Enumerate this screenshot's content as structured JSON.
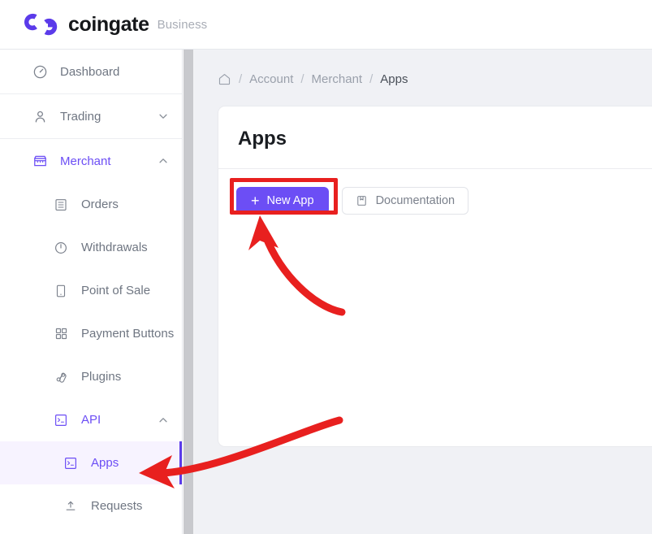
{
  "topbar": {
    "logo_icon": "coingate-cg-logo-icon",
    "brand_name": "coingate",
    "brand_suffix": "Business",
    "brand_color": "#5b3bea"
  },
  "sidebar": {
    "groups": [
      {
        "items": [
          {
            "label": "Dashboard",
            "icon": "speedometer-icon",
            "state": "default",
            "expandable": false
          }
        ]
      },
      {
        "items": [
          {
            "label": "Trading",
            "icon": "user-icon",
            "state": "default",
            "expandable": true,
            "chevron": "chevron-down-icon"
          }
        ]
      },
      {
        "items": [
          {
            "label": "Merchant",
            "icon": "store-icon",
            "state": "accent",
            "expandable": true,
            "chevron": "chevron-up-icon"
          },
          {
            "label": "Orders",
            "icon": "list-icon",
            "state": "default",
            "sub": true
          },
          {
            "label": "Withdrawals",
            "icon": "power-icon",
            "state": "default",
            "sub": true
          },
          {
            "label": "Point of Sale",
            "icon": "device-icon",
            "state": "default",
            "sub": true
          },
          {
            "label": "Payment Buttons",
            "icon": "grid-icon",
            "state": "default",
            "sub": true
          },
          {
            "label": "Plugins",
            "icon": "plug-icon",
            "state": "default",
            "sub": true
          },
          {
            "label": "API",
            "icon": "terminal-icon",
            "state": "accent",
            "sub": true,
            "expandable": true,
            "chevron": "chevron-up-icon"
          },
          {
            "label": "Apps",
            "icon": "terminal-icon",
            "state": "active",
            "sub2": true
          },
          {
            "label": "Requests",
            "icon": "upload-icon",
            "state": "default",
            "sub2": true
          }
        ]
      }
    ],
    "active_item": "Apps",
    "active_bg": "#f7f3ff",
    "active_color": "#6c4ef5"
  },
  "breadcrumb": {
    "home_icon": "home-icon",
    "separator": "/",
    "items": [
      {
        "label": "Account",
        "current": false
      },
      {
        "label": "Merchant",
        "current": false
      },
      {
        "label": "Apps",
        "current": true
      }
    ]
  },
  "card": {
    "title": "Apps",
    "buttons": {
      "new_app": {
        "label": "New App",
        "icon": "plus-icon",
        "style": "primary",
        "color": "#6c4ef5"
      },
      "documentation": {
        "label": "Documentation",
        "icon": "book-icon",
        "style": "secondary"
      }
    }
  },
  "annotations": {
    "highlight_color": "#e8201f",
    "highlight_box_target": "New App",
    "arrows": [
      {
        "name": "arrow-to-new-app-button",
        "points_to": "New App",
        "direction": "up-left"
      },
      {
        "name": "arrow-to-apps-sidebar-item",
        "points_to": "Apps",
        "direction": "left"
      }
    ]
  }
}
